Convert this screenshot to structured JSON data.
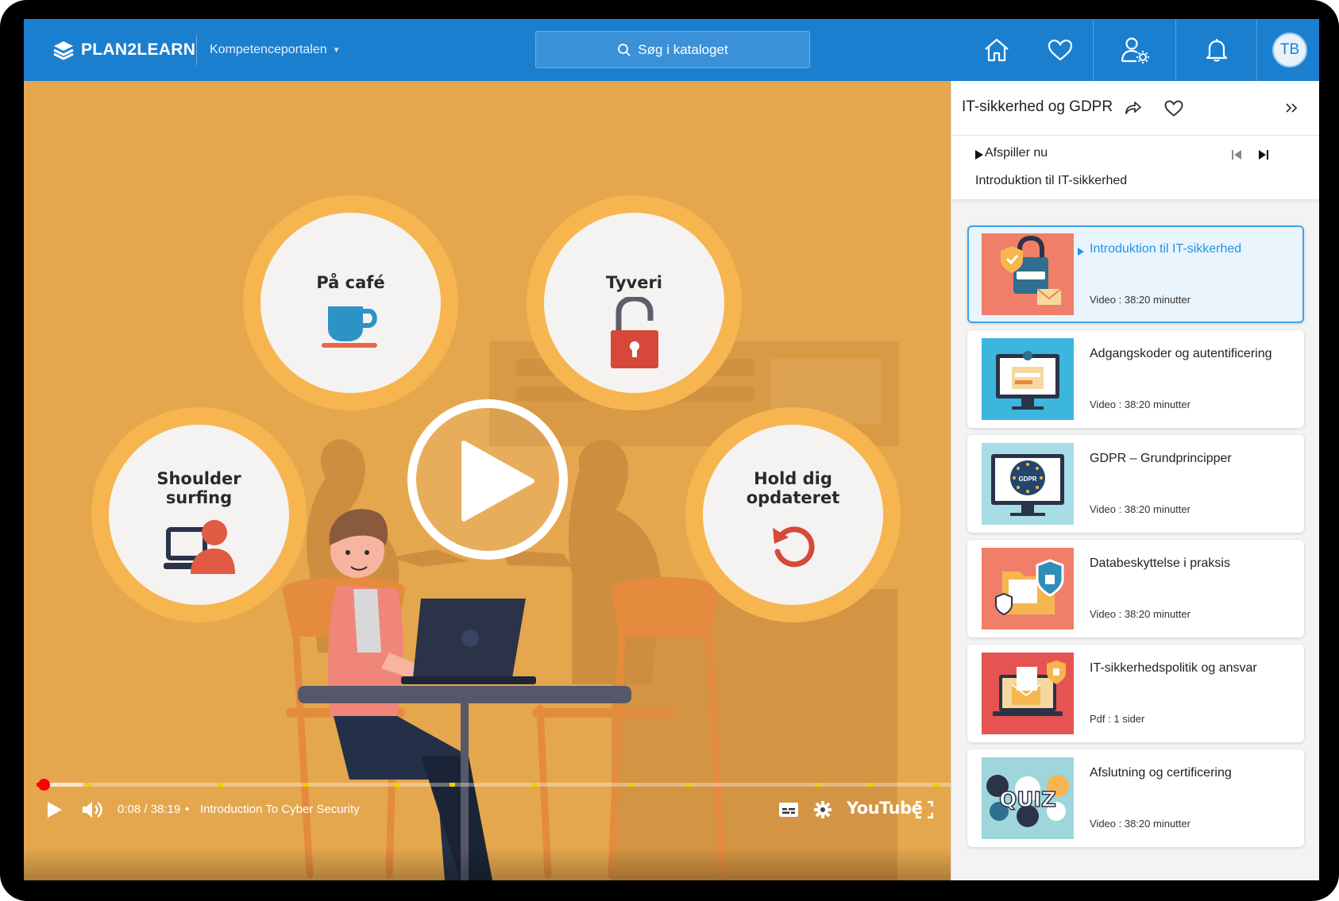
{
  "header": {
    "logo_text": "PLAN2LEARN",
    "portal_label": "Kompetenceportalen",
    "search_placeholder": "Søg i kataloget",
    "avatar_initials": "TB"
  },
  "video": {
    "bubbles": [
      {
        "label": "På café",
        "icon": "coffee-cup-icon"
      },
      {
        "label": "Tyveri",
        "icon": "open-padlock-icon"
      },
      {
        "label": "Shoulder\nsurfing",
        "icon": "user-at-laptop-icon"
      },
      {
        "label": "Hold dig\nopdateret",
        "icon": "refresh-arrow-icon"
      }
    ],
    "player": {
      "time_display": "0:08 / 38:19",
      "separator": "•",
      "title": "Introduction To Cyber Security",
      "youtube_label": "YouTube",
      "progress_played": 0.008,
      "progress_buffered": 0.05
    }
  },
  "sidebar": {
    "course_title": "IT-sikkerhed og GDPR",
    "now_playing_label": "Afspiller nu",
    "now_playing_title": "Introduktion til IT-sikkerhed",
    "items": [
      {
        "title": "Introduktion til IT-sikkerhed",
        "meta": "Video : 38:20 minutter",
        "active": true,
        "thumb": "padlock-shield-thumb"
      },
      {
        "title": "Adgangskoder og autentificering",
        "meta": "Video : 38:20 minutter",
        "active": false,
        "thumb": "monitor-login-thumb"
      },
      {
        "title": "GDPR – Grundprincipper",
        "meta": "Video : 38:20 minutter",
        "active": false,
        "thumb": "gdpr-monitor-thumb"
      },
      {
        "title": "Databeskyttelse i praksis",
        "meta": "Video : 38:20 minutter",
        "active": false,
        "thumb": "folder-shield-thumb"
      },
      {
        "title": "IT-sikkerhedspolitik og ansvar",
        "meta": "Pdf : 1 sider",
        "active": false,
        "thumb": "laptop-email-thumb"
      },
      {
        "title": "Afslutning og certificering",
        "meta": "Video : 38:20 minutter",
        "active": false,
        "thumb": "quiz-thumb"
      }
    ]
  },
  "colors": {
    "brand_blue": "#1b7fd0",
    "video_bg": "#e5a74e",
    "bubble_ring": "#f7b54f",
    "active_item": "#3ca3e8",
    "progress_red": "#ff0000"
  }
}
